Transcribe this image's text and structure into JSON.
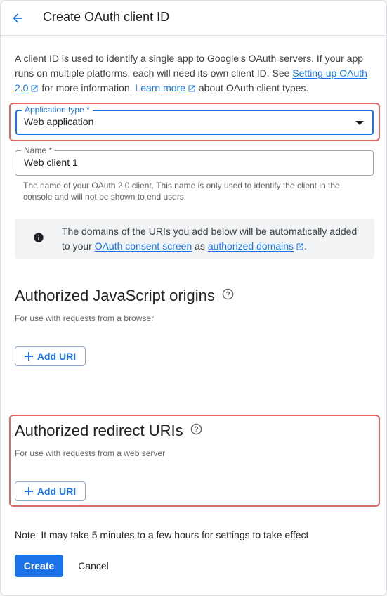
{
  "header": {
    "title": "Create OAuth client ID",
    "back_icon": "arrow-back-icon"
  },
  "intro": {
    "text_1": "A client ID is used to identify a single app to Google's OAuth servers. If your app runs on multiple platforms, each will need its own client ID. See ",
    "link_1": "Setting up OAuth 2.0",
    "text_2": " for more information. ",
    "link_2": "Learn more",
    "text_3": " about OAuth client types."
  },
  "application_type": {
    "label": "Application type *",
    "value": "Web application"
  },
  "name": {
    "label": "Name *",
    "value": "Web client 1",
    "helper": "The name of your OAuth 2.0 client. This name is only used to identify the client in the console and will not be shown to end users."
  },
  "notice": {
    "text_1": "The domains of the URIs you add below will be automatically added to your ",
    "link_1": "OAuth consent screen",
    "text_2": " as ",
    "link_2": "authorized domains",
    "text_3": "."
  },
  "js_origins": {
    "title": "Authorized JavaScript origins",
    "subtitle": "For use with requests from a browser",
    "add_label": "Add URI"
  },
  "redirect_uris": {
    "title": "Authorized redirect URIs",
    "subtitle": "For use with requests from a web server",
    "add_label": "Add URI"
  },
  "footer": {
    "note": "Note: It may take 5 minutes to a few hours for settings to take effect",
    "create_label": "Create",
    "cancel_label": "Cancel"
  },
  "colors": {
    "accent": "#1a73e8",
    "highlight": "#e06666",
    "text": "#202124"
  }
}
